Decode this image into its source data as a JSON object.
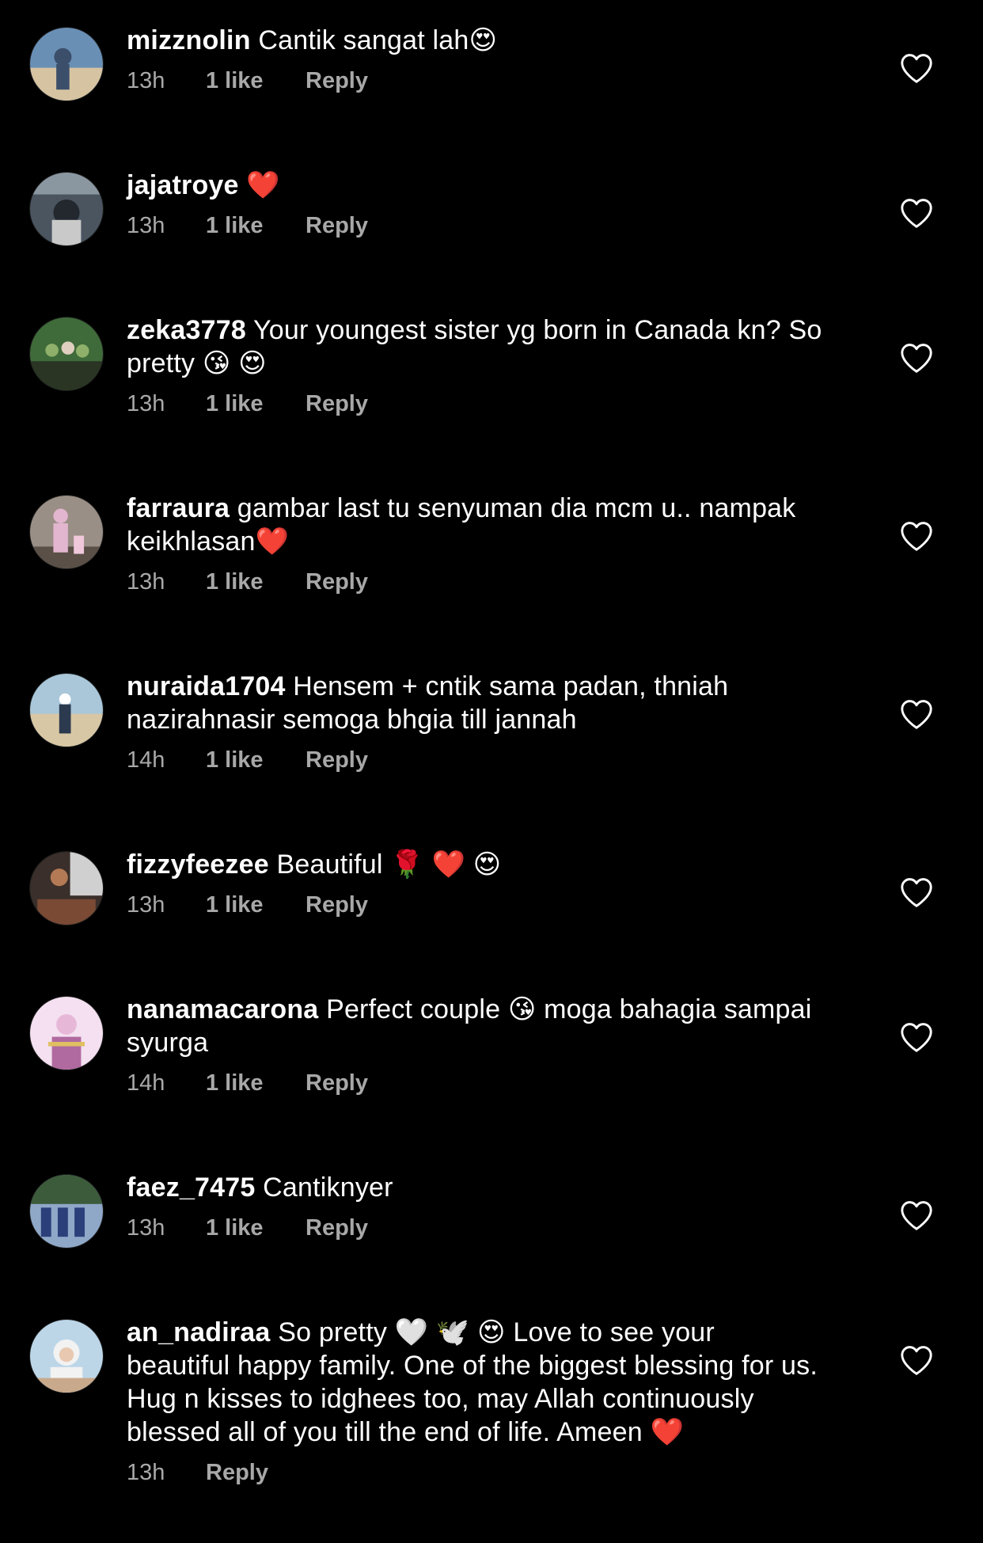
{
  "comments": [
    {
      "username": "mizznolin",
      "text": "Cantik sangat lah😍",
      "time": "13h",
      "likes": "1 like",
      "reply": "Reply",
      "avatar_colors": [
        "#6a8fb5",
        "#d6c3a1",
        "#3b4f6b"
      ]
    },
    {
      "username": "jajatroye",
      "text": "❤️",
      "time": "13h",
      "likes": "1 like",
      "reply": "Reply",
      "avatar_colors": [
        "#4a5560",
        "#c9c9c9",
        "#22282e"
      ]
    },
    {
      "username": "zeka3778",
      "text": "Your youngest sister yg born in Canada kn? So pretty 😘 😍",
      "time": "13h",
      "likes": "1 like",
      "reply": "Reply",
      "avatar_colors": [
        "#3f6b3a",
        "#8fb06a",
        "#2a3524"
      ]
    },
    {
      "username": "farraura",
      "text": "gambar last tu senyuman dia mcm u.. nampak keikhlasan❤️",
      "time": "13h",
      "likes": "1 like",
      "reply": "Reply",
      "avatar_colors": [
        "#9a8f86",
        "#e2b6cf",
        "#5a5048"
      ]
    },
    {
      "username": "nuraida1704",
      "text": "Hensem + cntik sama padan, thniah nazirahnasir semoga bhgia till jannah",
      "time": "14h",
      "likes": "1 like",
      "reply": "Reply",
      "avatar_colors": [
        "#a9c7d9",
        "#d8c7a4",
        "#2c3a4f"
      ]
    },
    {
      "username": "fizzyfeezee",
      "text": "Beautiful 🌹 ❤️ 😍",
      "time": "13h",
      "likes": "1 like",
      "reply": "Reply",
      "avatar_colors": [
        "#3a2f2a",
        "#b47a55",
        "#d0d0d0"
      ]
    },
    {
      "username": "nanamacarona",
      "text": "Perfect couple 😘 moga bahagia sampai syurga",
      "time": "14h",
      "likes": "1 like",
      "reply": "Reply",
      "avatar_colors": [
        "#e7b7d8",
        "#f4e0f0",
        "#b06aa0"
      ]
    },
    {
      "username": "faez_7475",
      "text": "Cantiknyer",
      "time": "13h",
      "likes": "1 like",
      "reply": "Reply",
      "avatar_colors": [
        "#3b5b3a",
        "#2b3f7a",
        "#8fa8c8"
      ]
    },
    {
      "username": "an_nadiraa",
      "text": "So pretty 🤍 🕊️ 😍 Love to see your beautiful happy family. One of the biggest blessing for us. Hug n kisses to idghees too, may Allah continuously blessed all of you till the end of life. Ameen ❤️",
      "time": "13h",
      "likes": "",
      "reply": "Reply",
      "avatar_colors": [
        "#bcd6e8",
        "#f2f2f2",
        "#c9a98b"
      ]
    }
  ],
  "icons": {
    "like": "heart-outline-icon"
  },
  "colors": {
    "background": "#000000",
    "text": "#ffffff",
    "meta": "#a8a8a8"
  }
}
